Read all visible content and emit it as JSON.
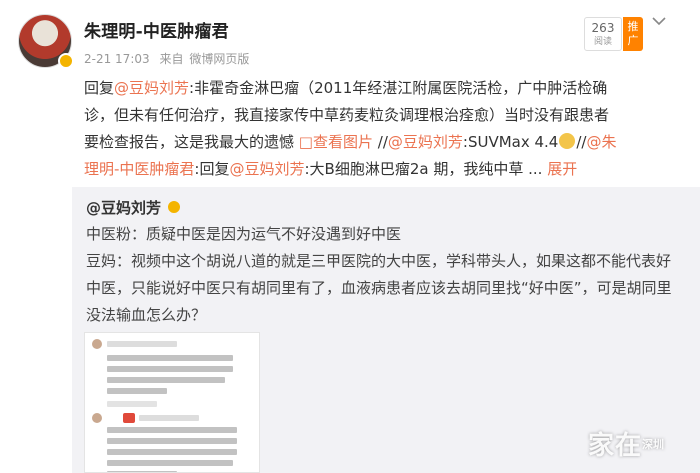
{
  "post": {
    "author": "朱理明-中医肿瘤君",
    "time": "2-21 17:03",
    "source_prefix": "来自",
    "source": "微博网页版",
    "read_count": "263",
    "read_label": "阅读",
    "promote_label": "推广",
    "content": {
      "p1": "回复",
      "mention1": "@豆妈刘芳",
      "p2": ":非霍奇金淋巴瘤（2011年经湛江附属医院活检，广中肿活检确诊，但未有任何治疗，我直接家传中草药麦粒灸调理根治痊愈）当时没有跟患者要检查报告，这是我最大的遗憾",
      "view_image": "查看图片",
      "p3": " //",
      "mention2": "@豆妈刘芳",
      "p4": ":SUVMax 4.4",
      "p5": "//",
      "mention3": "@朱理明-中医肿瘤君",
      "p6": ":回复",
      "mention4": "@豆妈刘芳",
      "p7": ":大B细胞淋巴瘤2a 期，我纯中草 ...",
      "expand": "展开"
    }
  },
  "repost": {
    "author": "@豆妈刘芳",
    "line1": "中医粉：质疑中医是因为运气不好没遇到好中医",
    "line2": "豆妈：视频中这个胡说八道的就是三甲医院的大中医，学科带头人，如果这都不能代表好中医，只能说好中医只有胡同里有了，血液病患者应该去胡同里找“好中医”，可是胡同里没法输血怎么办？"
  },
  "watermark": {
    "text": "家在",
    "sub": "深圳"
  },
  "colors": {
    "mention": "#eb7350",
    "promote": "#ff8200",
    "repost_bg": "#f2f2f5"
  }
}
